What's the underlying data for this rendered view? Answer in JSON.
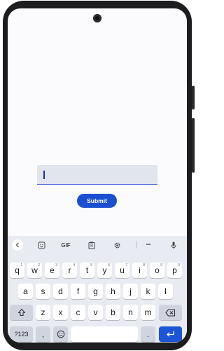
{
  "form": {
    "input_value": "",
    "submit_label": "Submit"
  },
  "keyboard": {
    "toolbar": {
      "back_icon": "chevron-left-icon",
      "sticker_icon": "sticker-icon",
      "gif_label": "GIF",
      "clipboard_icon": "clipboard-icon",
      "settings_icon": "gear-icon",
      "more_label": "•••",
      "mic_icon": "microphone-icon"
    },
    "row1": [
      {
        "key": "q",
        "hint": "1"
      },
      {
        "key": "w",
        "hint": "2"
      },
      {
        "key": "e",
        "hint": "3"
      },
      {
        "key": "r",
        "hint": "4"
      },
      {
        "key": "t",
        "hint": "5"
      },
      {
        "key": "y",
        "hint": "6"
      },
      {
        "key": "u",
        "hint": "7"
      },
      {
        "key": "i",
        "hint": "8"
      },
      {
        "key": "o",
        "hint": "9"
      },
      {
        "key": "p",
        "hint": "0"
      }
    ],
    "row2": [
      "a",
      "s",
      "d",
      "f",
      "g",
      "h",
      "j",
      "k",
      "l"
    ],
    "row3": [
      "z",
      "x",
      "c",
      "v",
      "b",
      "n",
      "m"
    ],
    "symbols_label": "?123",
    "comma_label": ",",
    "period_label": ".",
    "shift_icon": "shift-icon",
    "backspace_icon": "backspace-icon",
    "emoji_icon": "emoji-icon",
    "enter_icon": "enter-icon",
    "accent_color": "#1a4fd1"
  }
}
